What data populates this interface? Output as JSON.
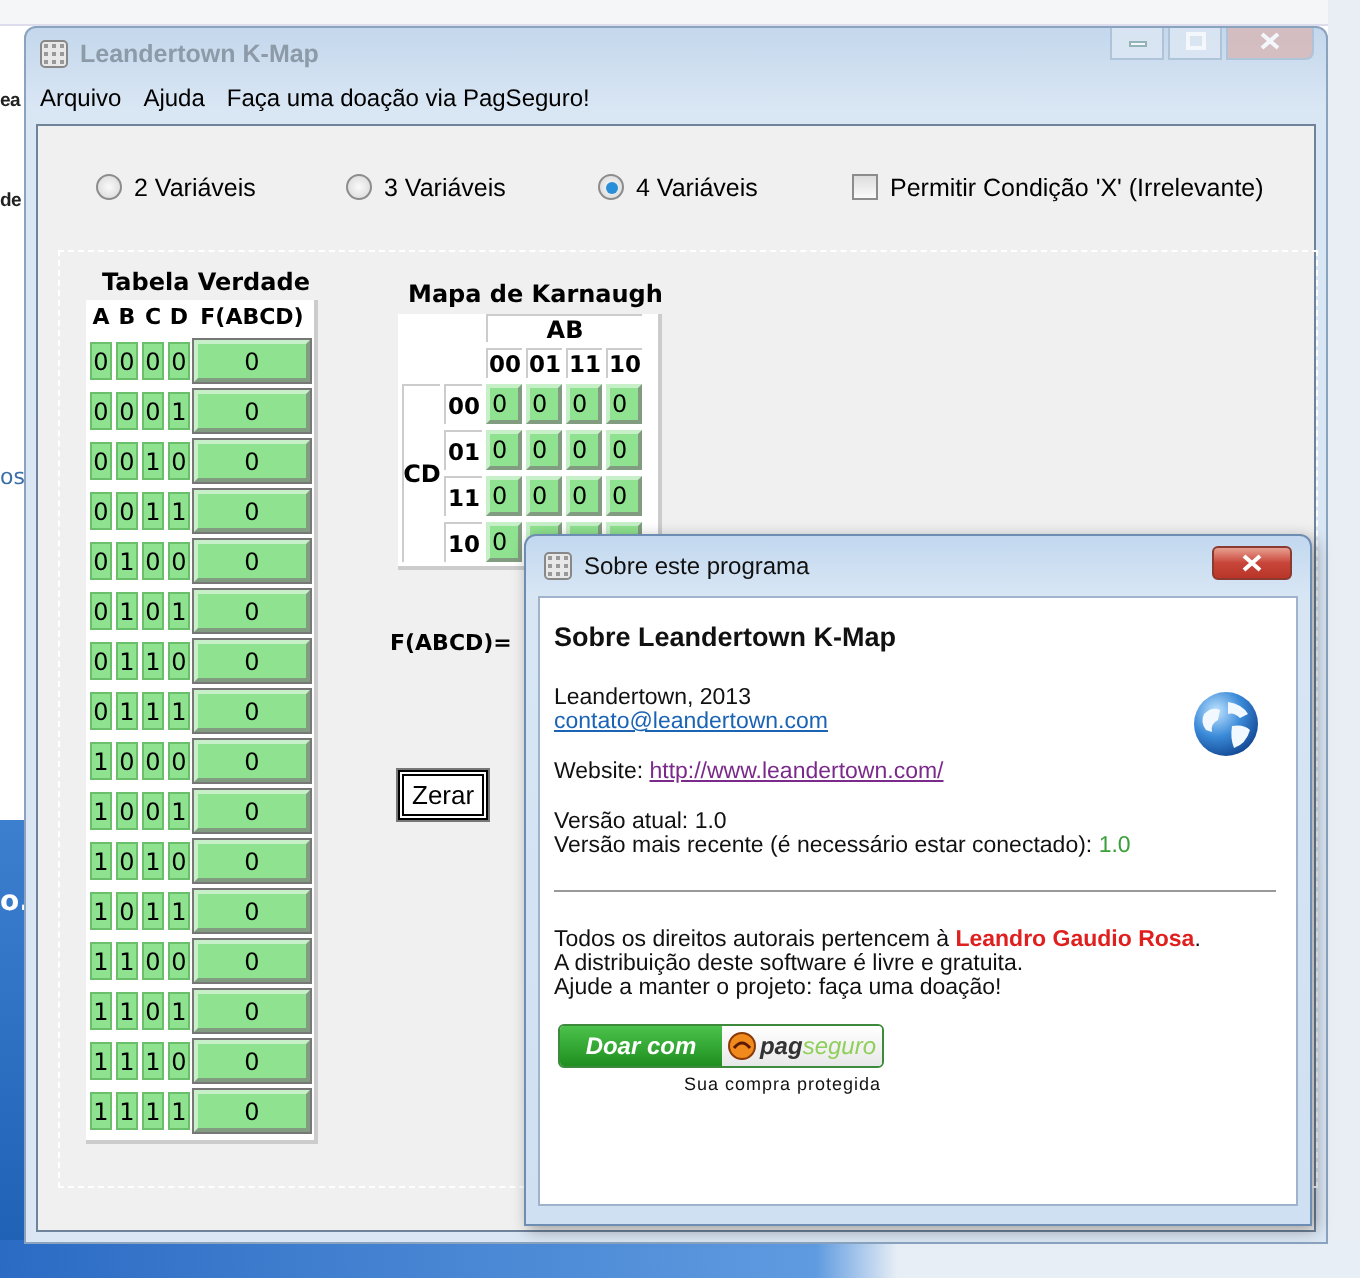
{
  "desktop": {
    "fragments": [
      {
        "text": "ea",
        "kind": "dark"
      },
      {
        "text": "de",
        "kind": "dark"
      },
      {
        "text": "os",
        "kind": "link"
      },
      {
        "text": "o.",
        "kind": "light"
      }
    ]
  },
  "window": {
    "title": "Leandertown K-Map",
    "active": false
  },
  "menu": [
    {
      "label": "Arquivo"
    },
    {
      "label": "Ajuda"
    },
    {
      "label": "Faça uma doação via PagSeguro!"
    }
  ],
  "options": {
    "radios": [
      {
        "label": "2 Variáveis",
        "selected": false
      },
      {
        "label": "3 Variáveis",
        "selected": false
      },
      {
        "label": "4 Variáveis",
        "selected": true
      }
    ],
    "checkbox": {
      "label": "Permitir Condição 'X' (Irrelevante)",
      "checked": false
    }
  },
  "truth_table": {
    "title": "Tabela Verdade",
    "columns": [
      "A",
      "B",
      "C",
      "D",
      "F(ABCD)"
    ],
    "rows": [
      [
        "0",
        "0",
        "0",
        "0",
        "0"
      ],
      [
        "0",
        "0",
        "0",
        "1",
        "0"
      ],
      [
        "0",
        "0",
        "1",
        "0",
        "0"
      ],
      [
        "0",
        "0",
        "1",
        "1",
        "0"
      ],
      [
        "0",
        "1",
        "0",
        "0",
        "0"
      ],
      [
        "0",
        "1",
        "0",
        "1",
        "0"
      ],
      [
        "0",
        "1",
        "1",
        "0",
        "0"
      ],
      [
        "0",
        "1",
        "1",
        "1",
        "0"
      ],
      [
        "1",
        "0",
        "0",
        "0",
        "0"
      ],
      [
        "1",
        "0",
        "0",
        "1",
        "0"
      ],
      [
        "1",
        "0",
        "1",
        "0",
        "0"
      ],
      [
        "1",
        "0",
        "1",
        "1",
        "0"
      ],
      [
        "1",
        "1",
        "0",
        "0",
        "0"
      ],
      [
        "1",
        "1",
        "0",
        "1",
        "0"
      ],
      [
        "1",
        "1",
        "1",
        "0",
        "0"
      ],
      [
        "1",
        "1",
        "1",
        "1",
        "0"
      ]
    ]
  },
  "kmap": {
    "title": "Mapa de Karnaugh",
    "col_var": "AB",
    "row_var": "CD",
    "col_labels": [
      "00",
      "01",
      "11",
      "10"
    ],
    "row_labels": [
      "00",
      "01",
      "11",
      "10"
    ],
    "cells": [
      [
        "0",
        "0",
        "0",
        "0"
      ],
      [
        "0",
        "0",
        "0",
        "0"
      ],
      [
        "0",
        "0",
        "0",
        "0"
      ],
      [
        "0"
      ]
    ]
  },
  "expression": {
    "label": "F(ABCD)="
  },
  "reset_button": {
    "label": "Zerar"
  },
  "dialog": {
    "title": "Sobre este programa",
    "heading": "Sobre Leandertown K-Map",
    "author": "Leandertown, 2013",
    "email": "contato@leandertown.com",
    "website_label": "Website:",
    "website": "http://www.leandertown.com/",
    "current_version": "Versão atual: 1.0",
    "latest_label": "Versão mais recente (é necessário estar conectado):",
    "latest_value": "1.0",
    "rights": "Todos os direitos autorais pertencem à **Leandro Gaudio Rosa**.",
    "lines": [
      "A distribuição deste software é livre e gratuita.",
      "Ajude a manter o projeto: faça uma doação!"
    ],
    "donate": {
      "label": "Doar com",
      "brand": "**pag**seguro",
      "caption": "Sua compra protegida"
    }
  }
}
